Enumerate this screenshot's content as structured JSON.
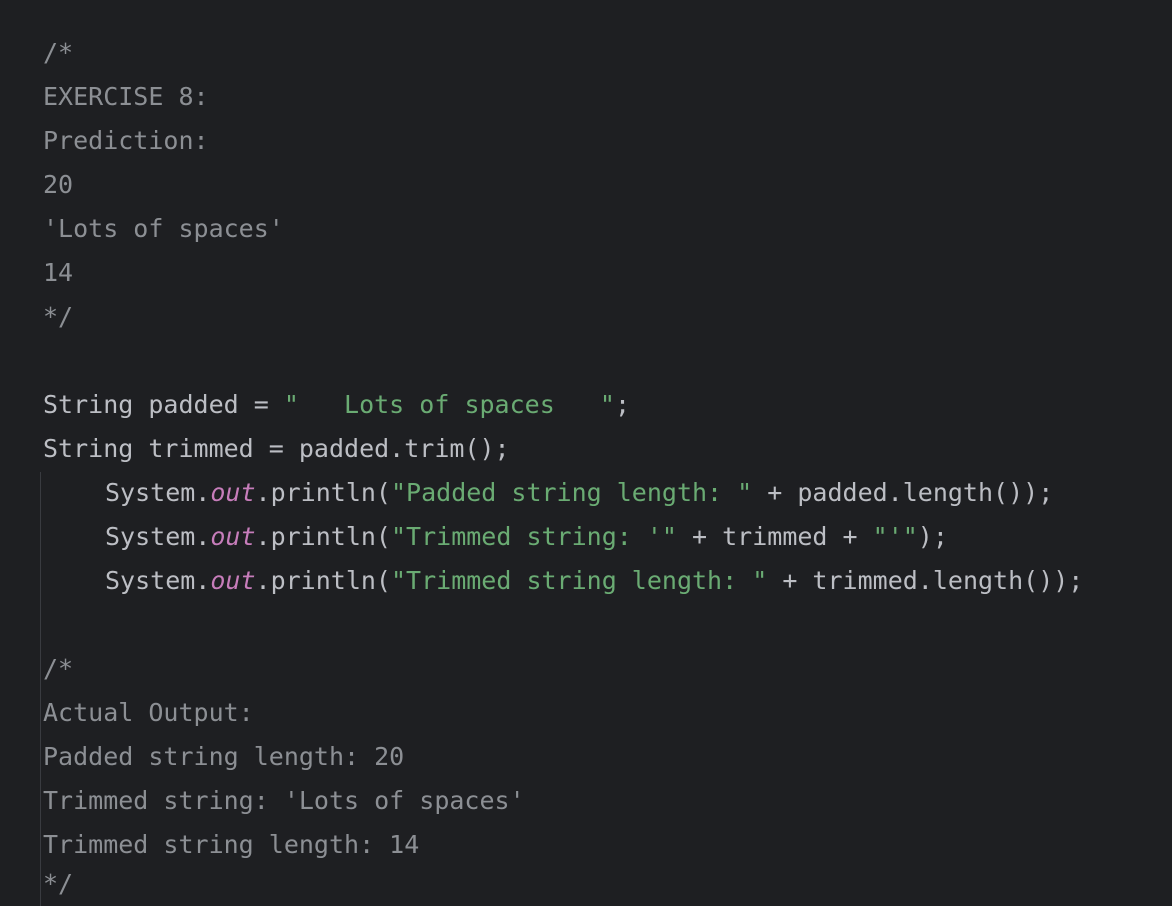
{
  "editor": {
    "lines": [
      "/*",
      "EXERCISE 8:",
      "Prediction:",
      "20",
      "'Lots of spaces'",
      "14",
      "*/",
      "",
      "String padded = \"   Lots of spaces   \";",
      "String trimmed = padded.trim();",
      "    System.out.println(\"Padded string length: \" + padded.length());",
      "    System.out.println(\"Trimmed string: '\" + trimmed + \"'\");",
      "    System.out.println(\"Trimmed string length: \" + trimmed.length());",
      "",
      "/*",
      "Actual Output:",
      "Padded string length: 20",
      "Trimmed string: 'Lots of spaces'",
      "Trimmed string length: 14",
      "*/"
    ],
    "tokens": {
      "line9": {
        "kw": "String padded = ",
        "str": "\"   Lots of spaces   \"",
        "end": ";"
      },
      "line10": {
        "text": "String trimmed = padded.trim();"
      },
      "line11": {
        "a": "System.",
        "field": "out",
        "b": ".println(",
        "str": "\"Padded string length: \"",
        "c": " + padded.length());"
      },
      "line12": {
        "a": "System.",
        "field": "out",
        "b": ".println(",
        "str1": "\"Trimmed string: '\"",
        "c": " + trimmed + ",
        "str2": "\"'\"",
        "d": ");"
      },
      "line13": {
        "a": "System.",
        "field": "out",
        "b": ".println(",
        "str": "\"Trimmed string length: \"",
        "c": " + trimmed.length());"
      }
    }
  },
  "theme": {
    "background": "#1e1f22",
    "text": "#bcbec4",
    "comment": "#8c8f94",
    "string": "#6aab73",
    "static_field": "#c77dbb"
  }
}
